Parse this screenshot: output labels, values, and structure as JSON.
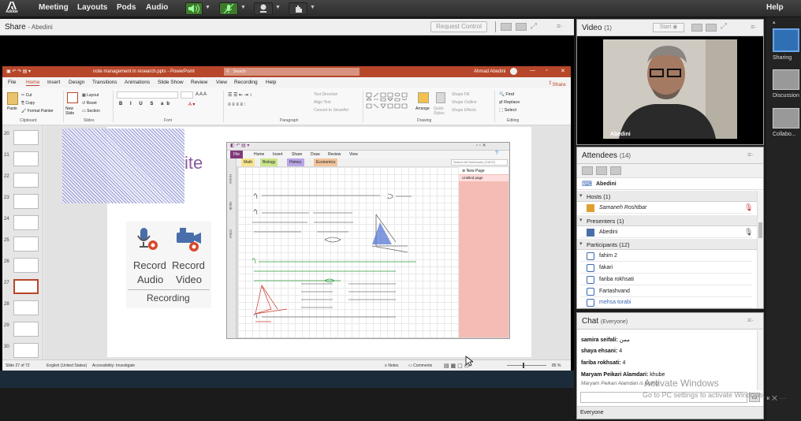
{
  "app": {
    "logo_text": "Adobe"
  },
  "menu": {
    "meeting": "Meeting",
    "layouts": "Layouts",
    "pods": "Pods",
    "audio": "Audio",
    "help": "Help"
  },
  "share": {
    "title": "Share",
    "presenter": "- Abedini",
    "request_control": "Request Control"
  },
  "ppt": {
    "file_name": "note management in research.pptx - PowerPoint",
    "search": "Search",
    "user": "Ahmad Abedini",
    "tabs": [
      "File",
      "Home",
      "Insert",
      "Design",
      "Transitions",
      "Animations",
      "Slide Show",
      "Review",
      "View",
      "Recording",
      "Help"
    ],
    "share_btn": "Share",
    "ribbon_groups": [
      "Clipboard",
      "Slides",
      "Font",
      "Paragraph",
      "Drawing",
      "Editing"
    ],
    "ribbon": {
      "paste": "Paste",
      "cut": "Cut",
      "copy": "Copy",
      "format_painter": "Format Painter",
      "new_slide": "New Slide",
      "layout": "Layout",
      "reset": "Reset",
      "section": "Section",
      "find": "Find",
      "replace": "Replace",
      "select": "Select",
      "arrange": "Arrange",
      "quick_styles": "Quick Styles",
      "text_direction": "Text Direction",
      "align_text": "Align Text",
      "convert_smartart": "Convert to SmartArt",
      "shape_fill": "Shape Fill",
      "shape_outline": "Shape Outline",
      "shape_effects": "Shape Effects"
    },
    "slide_numbers": [
      "20",
      "21",
      "22",
      "23",
      "24",
      "25",
      "26",
      "27",
      "28",
      "29",
      "30"
    ],
    "slide": {
      "partial_title": "ite",
      "record_audio_1": "Record",
      "record_audio_2": "Audio",
      "record_video_1": "Record",
      "record_video_2": "Video",
      "recording": "Recording"
    },
    "status": {
      "slide_of": "Slide 27 of 72",
      "language": "English (United States)",
      "accessibility": "Accessibility: Investigate",
      "notes": "Notes",
      "comments": "Comments",
      "zoom": "85 %"
    }
  },
  "onenote": {
    "tabs": [
      "File",
      "Home",
      "Insert",
      "Share",
      "Draw",
      "Review",
      "View"
    ],
    "sections": [
      "Math",
      "Biology",
      "History",
      "Economics"
    ],
    "search": "Search All Notebooks (Ctrl+E)",
    "new_page": "New Page",
    "untitled": "Untitled page",
    "side": [
      "Home",
      "Work",
      "Other"
    ]
  },
  "video": {
    "title": "Video",
    "count": "(1)",
    "start": "Start",
    "name": "Abedini"
  },
  "attendees": {
    "title": "Attendees",
    "count": "(14)",
    "me": "Abedini",
    "hosts_label": "Hosts (1)",
    "hosts": [
      "Samaneh Roshtbar"
    ],
    "presenters_label": "Presenters (1)",
    "presenters": [
      "Abedini"
    ],
    "participants_label": "Participants (12)",
    "participants": [
      "fahim 2",
      "fakari",
      "fariba rokhsati",
      "Fartashvand",
      "mehsa torabi"
    ]
  },
  "chat": {
    "title": "Chat",
    "scope": "(Everyone)",
    "lines": [
      {
        "name": "samira seifali:",
        "msg": "ممن"
      },
      {
        "name": "shaya ehsani:",
        "msg": "4"
      },
      {
        "name": "fariba rokhsati:",
        "msg": "4"
      },
      {
        "name": "Maryam Peikari Alamdari:",
        "msg": "khube"
      }
    ],
    "typing": "Maryam Peikari Alamdari is typing",
    "recipient": "Everyone"
  },
  "watermark": {
    "line1": "Activate Windows",
    "line2": "Go to PC settings to activate Windows."
  },
  "layouts": [
    "Sharing",
    "Discussion",
    "Collabo..."
  ],
  "colors": {
    "ppt_brand": "#b7472a",
    "pod_header": "#efefef",
    "green_accent": "#3d7a2c"
  }
}
